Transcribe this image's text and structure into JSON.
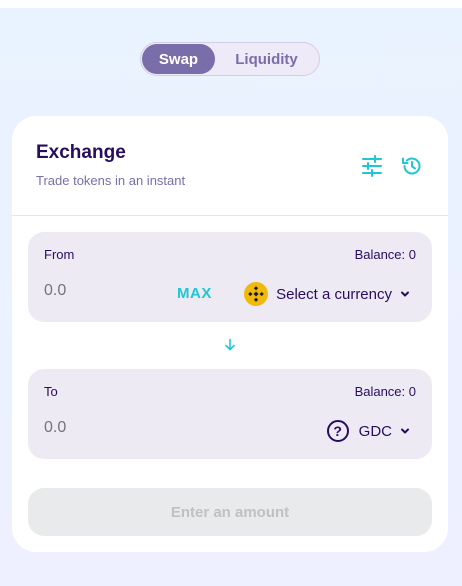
{
  "nav": {
    "tabs": [
      {
        "label": "Swap",
        "active": true
      },
      {
        "label": "Liquidity",
        "active": false
      }
    ]
  },
  "exchange": {
    "title": "Exchange",
    "subtitle": "Trade tokens in an instant",
    "icons": [
      "settings-icon",
      "history-icon"
    ]
  },
  "from": {
    "label": "From",
    "balance": "Balance: 0",
    "amount_placeholder": "0.0",
    "max_label": "MAX",
    "currency_label": "Select a currency",
    "currency_icon": "bnb-token-icon"
  },
  "to": {
    "label": "To",
    "balance": "Balance: 0",
    "amount_placeholder": "0.0",
    "currency_label": "GDC",
    "currency_icon": "question-circle-icon"
  },
  "switch_icon": "arrow-down-icon",
  "submit": {
    "label": "Enter an amount",
    "disabled": true
  },
  "colors": {
    "primary": "#7a6eaa",
    "accent": "#1fc7d4",
    "text": "#280d5f",
    "bnb": "#f0b90b",
    "panel": "#eeeaf4"
  }
}
